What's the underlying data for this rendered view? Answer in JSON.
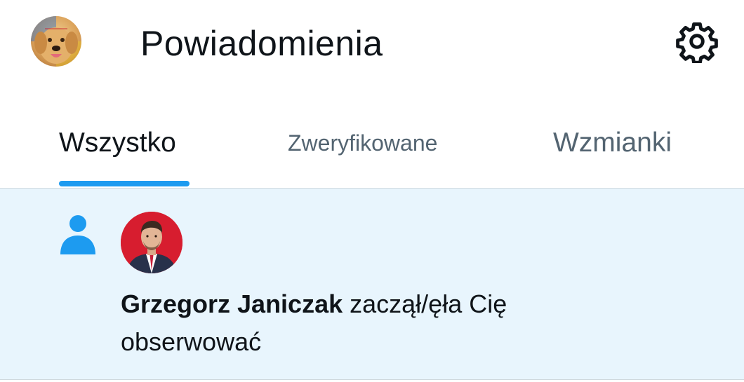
{
  "header": {
    "title": "Powiadomienia",
    "profile_icon": "profile-avatar-dog",
    "settings_icon": "gear-icon"
  },
  "tabs": [
    {
      "label": "Wszystko",
      "active": true
    },
    {
      "label": "Zweryfikowane",
      "active": false
    },
    {
      "label": "Wzmianki",
      "active": false
    }
  ],
  "notifications": [
    {
      "type_icon": "person-icon",
      "user_name": "Grzegorz Janiczak",
      "action_line1": "zaczął/ęła Cię",
      "action_line2": "obserwować"
    }
  ],
  "colors": {
    "accent": "#1d9bf0",
    "unread_background": "#e8f5fd",
    "primary_text": "#0f1419",
    "secondary_text": "#536471",
    "divider": "#cfd9de"
  }
}
